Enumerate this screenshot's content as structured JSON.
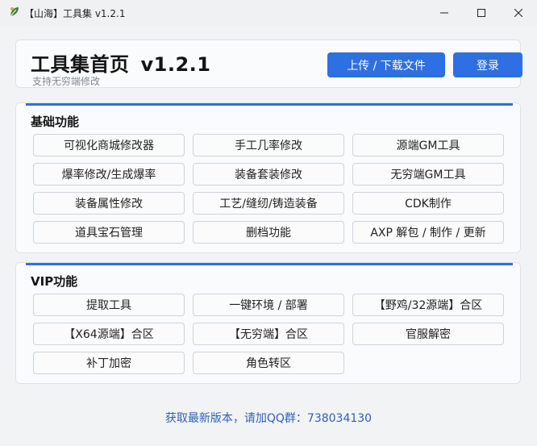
{
  "window": {
    "title": "【山海】工具集 v1.2.1",
    "icon": "leaf-app-icon",
    "controls": {
      "minimize": "minimize-icon",
      "maximize": "maximize-icon",
      "close": "close-icon"
    }
  },
  "header": {
    "title": "工具集首页",
    "version": "v1.2.1",
    "subtitle": "支持无穷端修改",
    "upload_label": "上传 / 下载文件",
    "login_label": "登录"
  },
  "colors": {
    "accent": "#2e6fe3",
    "footer_text": "#2f5fb8"
  },
  "basic": {
    "title": "基础功能",
    "buttons": [
      "可视化商城修改器",
      "手工几率修改",
      "源端GM工具",
      "爆率修改/生成爆率",
      "装备套装修改",
      "无穷端GM工具",
      "装备属性修改",
      "工艺/缝纫/铸造装备",
      "CDK制作",
      "道具宝石管理",
      "删档功能",
      "AXP 解包 / 制作 / 更新"
    ]
  },
  "vip": {
    "title": "VIP功能",
    "buttons": [
      "提取工具",
      "一键环境 / 部署",
      "【野鸡/32源端】合区",
      "【X64源端】合区",
      "【无穷端】合区",
      "官服解密",
      "补丁加密",
      "角色转区"
    ]
  },
  "footer": {
    "text": "获取最新版本，请加QQ群：738034130"
  }
}
